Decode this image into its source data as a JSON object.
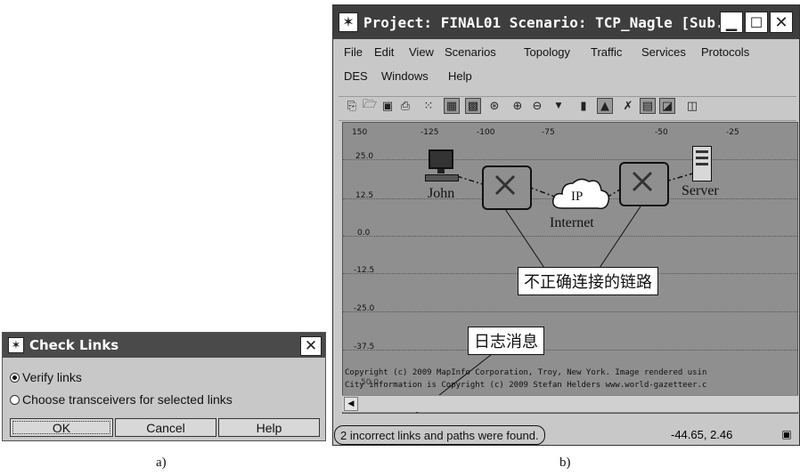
{
  "dialog": {
    "title": "Check Links",
    "options": [
      "Verify links",
      "Choose transceivers for selected links"
    ],
    "selected_option": "Verify links",
    "buttons": {
      "ok": "OK",
      "cancel": "Cancel",
      "help": "Help"
    }
  },
  "window": {
    "title": "Project: FINAL01 Scenario: TCP_Nagle  [Sub...",
    "menu": [
      "File",
      "Edit",
      "View",
      "Scenarios",
      "Topology",
      "Traffic",
      "Services",
      "Protocols",
      "DES",
      "Windows",
      "Help"
    ],
    "x_ticks": [
      "150",
      "-125",
      "-100",
      "-75",
      "-50",
      "-25"
    ],
    "y_ticks": [
      "25.0",
      "12.5",
      "0.0",
      "-12.5",
      "-25.0",
      "-37.5"
    ],
    "y_tick_overlap": "50.0",
    "nodes": {
      "client": "John",
      "server": "Server",
      "cloud_tag": "IP",
      "cloud_name": "Internet"
    },
    "copyright_lines": [
      "Copyright (c) 2009 MapInfo Corporation, Troy, New York. Image rendered usin",
      "City information is Copyright (c) 2009 Stefan Helders www.world-gazetteer.c"
    ],
    "status_message": "2 incorrect links and paths were found.",
    "coordinates": "-44.65, 2.46"
  },
  "annotations": {
    "incorrect_links": "不正确连接的链路",
    "log_message": "日志消息"
  },
  "captions": {
    "a": "a)",
    "b": "b)"
  }
}
